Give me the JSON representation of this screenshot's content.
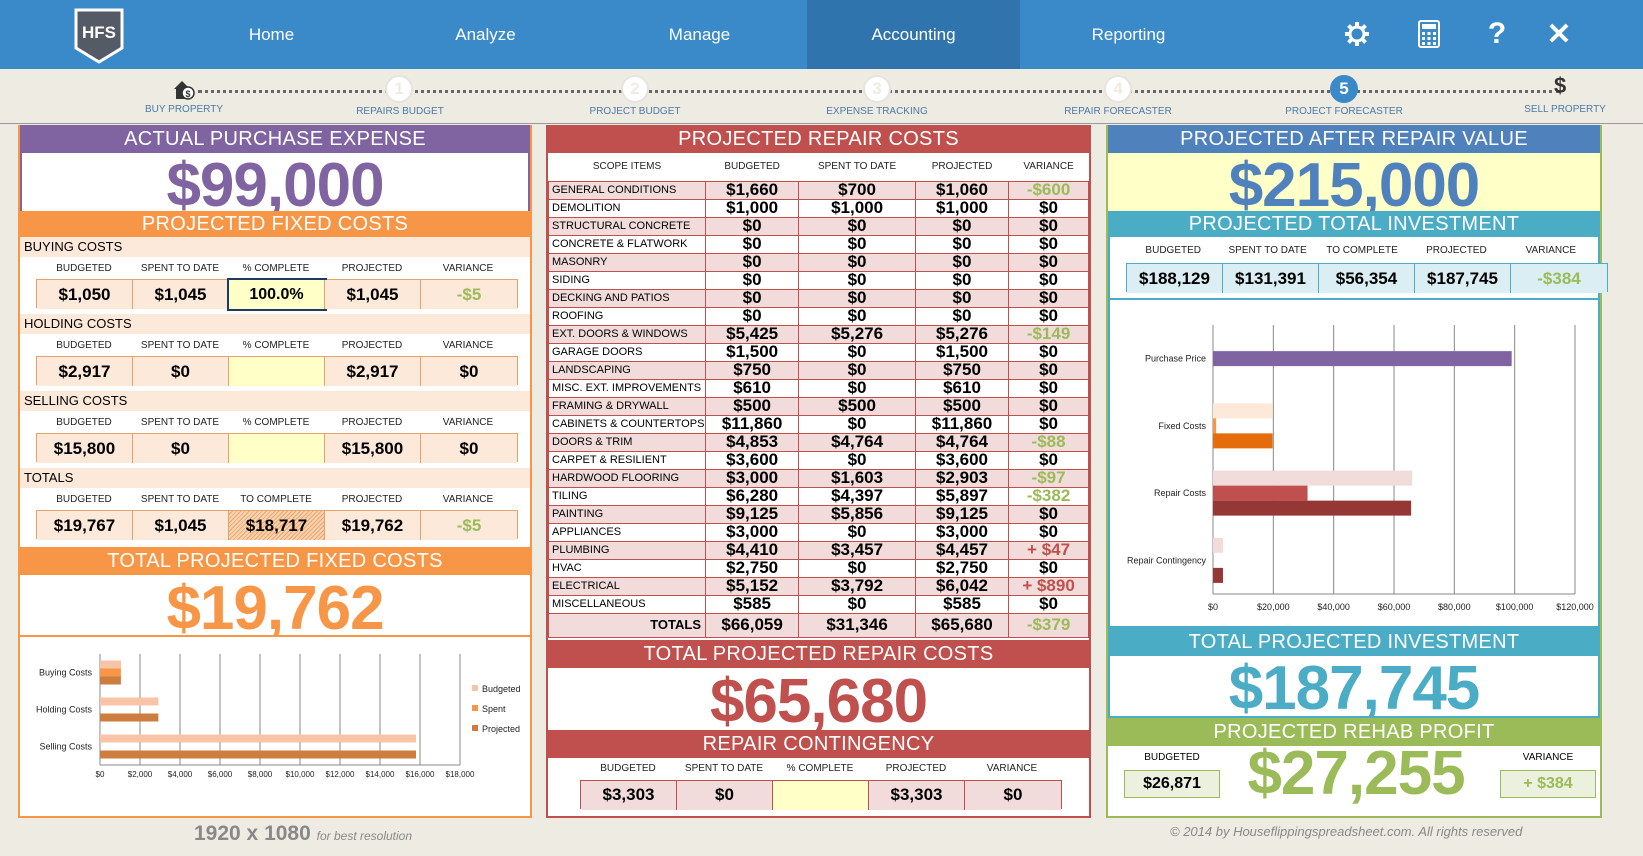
{
  "app": {
    "logo_text": "HFS"
  },
  "nav": {
    "items": [
      {
        "label": "Home"
      },
      {
        "label": "Analyze"
      },
      {
        "label": "Manage"
      },
      {
        "label": "Accounting",
        "active": true
      },
      {
        "label": "Reporting"
      }
    ],
    "icons": [
      "gear-icon",
      "calculator-icon",
      "help-icon",
      "close-icon"
    ]
  },
  "steps": [
    {
      "label": "BUY PROPERTY",
      "icon": "house-dollar-icon"
    },
    {
      "number": "1",
      "label": "REPAIRS BUDGET"
    },
    {
      "number": "2",
      "label": "PROJECT BUDGET"
    },
    {
      "number": "3",
      "label": "EXPENSE TRACKING"
    },
    {
      "number": "4",
      "label": "REPAIR FORECASTER"
    },
    {
      "number": "5",
      "label": "PROJECT FORECASTER",
      "active": true
    },
    {
      "label": "SELL PROPERTY",
      "icon": "dollar-icon"
    }
  ],
  "left": {
    "purchase_title": "ACTUAL PURCHASE EXPENSE",
    "purchase_value": "$99,000",
    "fixed_title": "PROJECTED FIXED COSTS",
    "sections": [
      {
        "label": "BUYING COSTS",
        "heads": [
          "BUDGETED",
          "SPENT TO DATE",
          "% COMPLETE",
          "PROJECTED",
          "VARIANCE"
        ],
        "values": [
          "$1,050",
          "$1,045",
          "100.0%",
          "$1,045",
          "-$5"
        ]
      },
      {
        "label": "HOLDING COSTS",
        "heads": [
          "BUDGETED",
          "SPENT TO DATE",
          "% COMPLETE",
          "PROJECTED",
          "VARIANCE"
        ],
        "values": [
          "$2,917",
          "$0",
          "",
          "$2,917",
          "$0"
        ]
      },
      {
        "label": "SELLING COSTS",
        "heads": [
          "BUDGETED",
          "SPENT TO DATE",
          "% COMPLETE",
          "PROJECTED",
          "VARIANCE"
        ],
        "values": [
          "$15,800",
          "$0",
          "",
          "$15,800",
          "$0"
        ]
      },
      {
        "label": "TOTALS",
        "heads": [
          "BUDGETED",
          "SPENT TO DATE",
          "TO COMPLETE",
          "PROJECTED",
          "VARIANCE"
        ],
        "values": [
          "$19,767",
          "$1,045",
          "$18,717",
          "$19,762",
          "-$5"
        ]
      }
    ],
    "total_title": "TOTAL PROJECTED FIXED COSTS",
    "total_value": "$19,762"
  },
  "middle": {
    "title": "PROJECTED REPAIR COSTS",
    "headers": [
      "SCOPE ITEMS",
      "BUDGETED",
      "SPENT TO DATE",
      "PROJECTED",
      "VARIANCE"
    ],
    "rows": [
      [
        "GENERAL CONDITIONS",
        "$1,660",
        "$700",
        "$1,060",
        "-$600"
      ],
      [
        "DEMOLITION",
        "$1,000",
        "$1,000",
        "$1,000",
        "$0"
      ],
      [
        "STRUCTURAL CONCRETE",
        "$0",
        "$0",
        "$0",
        "$0"
      ],
      [
        "CONCRETE & FLATWORK",
        "$0",
        "$0",
        "$0",
        "$0"
      ],
      [
        "MASONRY",
        "$0",
        "$0",
        "$0",
        "$0"
      ],
      [
        "SIDING",
        "$0",
        "$0",
        "$0",
        "$0"
      ],
      [
        "DECKING AND PATIOS",
        "$0",
        "$0",
        "$0",
        "$0"
      ],
      [
        "ROOFING",
        "$0",
        "$0",
        "$0",
        "$0"
      ],
      [
        "EXT. DOORS & WINDOWS",
        "$5,425",
        "$5,276",
        "$5,276",
        "-$149"
      ],
      [
        "GARAGE DOORS",
        "$1,500",
        "$0",
        "$1,500",
        "$0"
      ],
      [
        "LANDSCAPING",
        "$750",
        "$0",
        "$750",
        "$0"
      ],
      [
        "MISC. EXT. IMPROVEMENTS",
        "$610",
        "$0",
        "$610",
        "$0"
      ],
      [
        "FRAMING & DRYWALL",
        "$500",
        "$500",
        "$500",
        "$0"
      ],
      [
        "CABINETS & COUNTERTOPS",
        "$11,860",
        "$0",
        "$11,860",
        "$0"
      ],
      [
        "DOORS & TRIM",
        "$4,853",
        "$4,764",
        "$4,764",
        "-$88"
      ],
      [
        "CARPET & RESILIENT",
        "$3,600",
        "$0",
        "$3,600",
        "$0"
      ],
      [
        "HARDWOOD FLOORING",
        "$3,000",
        "$1,603",
        "$2,903",
        "-$97"
      ],
      [
        "TILING",
        "$6,280",
        "$4,397",
        "$5,897",
        "-$382"
      ],
      [
        "PAINTING",
        "$9,125",
        "$5,856",
        "$9,125",
        "$0"
      ],
      [
        "APPLIANCES",
        "$3,000",
        "$0",
        "$3,000",
        "$0"
      ],
      [
        "PLUMBING",
        "$4,410",
        "$3,457",
        "$4,457",
        "+ $47"
      ],
      [
        "HVAC",
        "$2,750",
        "$0",
        "$2,750",
        "$0"
      ],
      [
        "ELECTRICAL",
        "$5,152",
        "$3,792",
        "$6,042",
        "+ $890"
      ],
      [
        "MISCELLANEOUS",
        "$585",
        "$0",
        "$585",
        "$0"
      ]
    ],
    "totals": [
      "TOTALS",
      "$66,059",
      "$31,346",
      "$65,680",
      "-$379"
    ],
    "total_title": "TOTAL PROJECTED REPAIR COSTS",
    "total_value": "$65,680",
    "contingency_title": "REPAIR CONTINGENCY",
    "contingency_heads": [
      "BUDGETED",
      "SPENT TO DATE",
      "% COMPLETE",
      "PROJECTED",
      "VARIANCE"
    ],
    "contingency_values": [
      "$3,303",
      "$0",
      "",
      "$3,303",
      "$0"
    ]
  },
  "right": {
    "arv_title": "PROJECTED AFTER REPAIR VALUE",
    "arv_value": "$215,000",
    "inv_title": "PROJECTED TOTAL INVESTMENT",
    "inv_heads": [
      "BUDGETED",
      "SPENT TO DATE",
      "TO COMPLETE",
      "PROJECTED",
      "VARIANCE"
    ],
    "inv_values": [
      "$188,129",
      "$131,391",
      "$56,354",
      "$187,745",
      "-$384"
    ],
    "total_title": "TOTAL PROJECTED INVESTMENT",
    "total_value": "$187,745",
    "profit_title": "PROJECTED REHAB PROFIT",
    "profit_value": "$27,255",
    "profit_budgeted_label": "BUDGETED",
    "profit_budgeted": "$26,871",
    "profit_variance_label": "VARIANCE",
    "profit_variance": "+ $384"
  },
  "colors": {
    "purple": "#8064a2",
    "orange": "#f79646",
    "red": "#c0504d",
    "blue": "#4f81bd",
    "teal": "#4bacc6",
    "green": "#9bbb59"
  },
  "chart_data": [
    {
      "type": "bar",
      "orientation": "horizontal",
      "title": "",
      "categories": [
        "Buying Costs",
        "Holding Costs",
        "Selling Costs"
      ],
      "series": [
        {
          "name": "Budgeted",
          "values": [
            1050,
            2917,
            15800
          ],
          "color": "#f8c4a8"
        },
        {
          "name": "Spent",
          "values": [
            1045,
            0,
            0
          ],
          "color": "#f79646"
        },
        {
          "name": "Projected",
          "values": [
            1045,
            2917,
            15800
          ],
          "color": "#cd7d3f"
        }
      ],
      "xlim": [
        0,
        18000
      ],
      "ticks": [
        "$0",
        "$2,000",
        "$4,000",
        "$6,000",
        "$8,000",
        "$10,000",
        "$12,000",
        "$14,000",
        "$16,000",
        "$18,000"
      ],
      "grid": true,
      "legend": "right"
    },
    {
      "type": "bar",
      "orientation": "horizontal",
      "title": "",
      "categories": [
        "Purchase Price",
        "Fixed Costs",
        "Repair Costs",
        "Repair Contingency"
      ],
      "series_by_category": [
        [
          {
            "name": "Actual",
            "value": 99000,
            "color": "#8064a2"
          }
        ],
        [
          {
            "name": "Budgeted",
            "value": 19767,
            "color": "#fde9d9"
          },
          {
            "name": "Spent",
            "value": 1045,
            "color": "#f79646"
          },
          {
            "name": "Projected",
            "value": 19762,
            "color": "#e46c0a"
          }
        ],
        [
          {
            "name": "Budgeted",
            "value": 66059,
            "color": "#f2dcdb"
          },
          {
            "name": "Spent",
            "value": 31346,
            "color": "#c0504d"
          },
          {
            "name": "Projected",
            "value": 65680,
            "color": "#953735"
          }
        ],
        [
          {
            "name": "Budgeted",
            "value": 3303,
            "color": "#f2dcdb"
          },
          {
            "name": "Spent",
            "value": 0,
            "color": "#c0504d"
          },
          {
            "name": "Projected",
            "value": 3303,
            "color": "#953735"
          }
        ]
      ],
      "xlim": [
        0,
        120000
      ],
      "ticks": [
        "$0",
        "$20,000",
        "$40,000",
        "$60,000",
        "$80,000",
        "$100,000",
        "$120,000"
      ],
      "grid": true,
      "legend": "none"
    }
  ],
  "footer": {
    "resolution": "1920 x 1080",
    "resolution_note": "for best resolution",
    "copyright": "© 2014 by Houseflippingspreadsheet.com. All rights reserved"
  }
}
